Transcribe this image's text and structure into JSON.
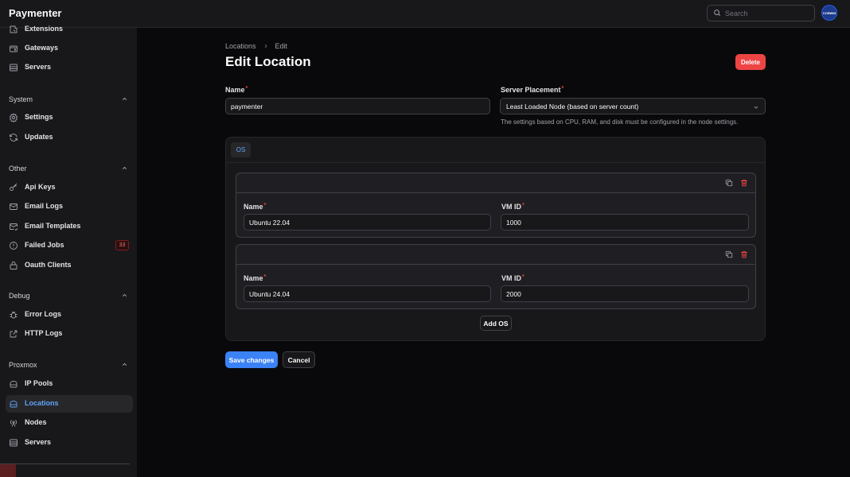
{
  "header": {
    "brand": "Paymenter",
    "search_placeholder": "Search",
    "avatar_text": "CORWIN"
  },
  "sidebar": {
    "top_items": [
      {
        "label": "Extensions",
        "icon": "puzzle-icon"
      },
      {
        "label": "Gateways",
        "icon": "wallet-icon"
      },
      {
        "label": "Servers",
        "icon": "server-icon"
      }
    ],
    "groups": [
      {
        "label": "System",
        "items": [
          {
            "label": "Settings",
            "icon": "gear-icon"
          },
          {
            "label": "Updates",
            "icon": "refresh-icon"
          }
        ]
      },
      {
        "label": "Other",
        "items": [
          {
            "label": "Api Keys",
            "icon": "key-icon"
          },
          {
            "label": "Email Logs",
            "icon": "mail-icon"
          },
          {
            "label": "Email Templates",
            "icon": "mail-check-icon"
          },
          {
            "label": "Failed Jobs",
            "icon": "alert-circle-icon",
            "badge": "33"
          },
          {
            "label": "Oauth Clients",
            "icon": "lock-icon"
          }
        ]
      },
      {
        "label": "Debug",
        "items": [
          {
            "label": "Error Logs",
            "icon": "bug-icon"
          },
          {
            "label": "HTTP Logs",
            "icon": "external-link-icon"
          }
        ]
      },
      {
        "label": "Proxmox",
        "items": [
          {
            "label": "IP Pools",
            "icon": "database-icon"
          },
          {
            "label": "Locations",
            "icon": "cloud-icon",
            "active": true
          },
          {
            "label": "Nodes",
            "icon": "antenna-icon"
          },
          {
            "label": "Servers",
            "icon": "server-icon"
          }
        ]
      }
    ]
  },
  "page": {
    "breadcrumbs": [
      "Locations",
      "Edit"
    ],
    "title": "Edit Location",
    "delete_label": "Delete",
    "name_label": "Name",
    "name_value": "paymenter",
    "placement_label": "Server Placement",
    "placement_value": "Least Loaded Node (based on server count)",
    "placement_hint": "The settings based on CPU, RAM, and disk must be configured in the node settings.",
    "os_tab": "OS",
    "os_name_label": "Name",
    "os_vmid_label": "VM ID",
    "os_items": [
      {
        "name": "Ubuntu 22.04",
        "vmid": "1000"
      },
      {
        "name": "Ubuntu 24.04",
        "vmid": "2000"
      }
    ],
    "add_os_label": "Add OS",
    "save_label": "Save changes",
    "cancel_label": "Cancel"
  },
  "colors": {
    "accent": "#60a5fa",
    "primary": "#3b82f6",
    "danger": "#ef4444",
    "background": "#09090b",
    "panel": "#18181b"
  }
}
